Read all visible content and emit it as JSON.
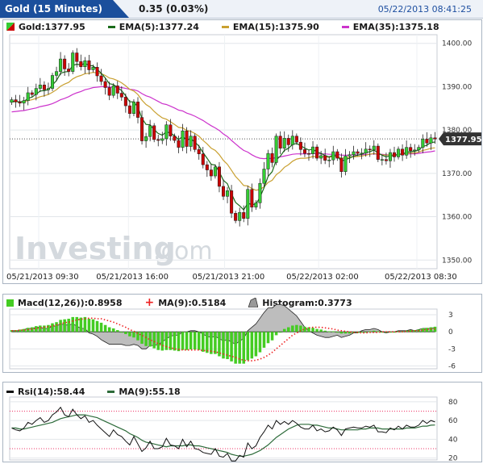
{
  "header": {
    "title": "Gold (15 Minutes)",
    "change": "0.35 (0.03%)",
    "timestamp": "05/22/2013 08:41:25"
  },
  "colors": {
    "up": "#33cc33",
    "down": "#cc0000",
    "ema5": "#1a6b1a",
    "ema15": "#c9a030",
    "ema35": "#cc33cc",
    "macd": "#44cc22",
    "macd_ma": "#ee2222",
    "histogram": "#999999",
    "rsi": "#111111",
    "rsi_ma": "#2d6b3a"
  },
  "main_legend": {
    "price_label": "Gold:1377.95",
    "ema5_label": "EMA(5):1377.24",
    "ema15_label": "EMA(15):1375.90",
    "ema35_label": "EMA(35):1375.18",
    "last_price_tag": "1377.95"
  },
  "macd_legend": {
    "macd_label": "Macd(12,26)):0.8958",
    "ma_label": "MA(9):0.5184",
    "hist_label": "Histogram:0.3773"
  },
  "rsi_legend": {
    "rsi_label": "Rsi(14):58.44",
    "ma_label": "MA(9):55.18"
  },
  "watermark": {
    "brand": "Investing",
    "suffix": ".com"
  },
  "chart_data": [
    {
      "type": "candlestick",
      "title": "Gold (15 Minutes)",
      "ylim": [
        1348,
        1402
      ],
      "y_ticks": [
        "1400.00",
        "1390.00",
        "1380.00",
        "1370.00",
        "1360.00",
        "1350.00"
      ],
      "x_ticks": [
        "05/21/2013 09:30",
        "05/21/2013 16:00",
        "05/21/2013 21:00",
        "05/22/2013 02:00",
        "05/22/2013 08:30"
      ],
      "series": [
        {
          "name": "Gold",
          "type": "candlestick",
          "last": 1377.95
        },
        {
          "name": "EMA(5)",
          "type": "line",
          "last": 1377.24
        },
        {
          "name": "EMA(15)",
          "type": "line",
          "last": 1375.9
        },
        {
          "name": "EMA(35)",
          "type": "line",
          "last": 1375.18
        }
      ],
      "close": [
        1387.0,
        1386.5,
        1386.2,
        1386.8,
        1388.6,
        1388.2,
        1389.6,
        1390.4,
        1389.3,
        1389.6,
        1392.6,
        1393.5,
        1396.4,
        1394.1,
        1393.5,
        1397.8,
        1395.8,
        1394.6,
        1396.0,
        1393.9,
        1394.5,
        1392.5,
        1391.2,
        1389.8,
        1388.0,
        1390.2,
        1388.5,
        1387.6,
        1385.6,
        1383.8,
        1386.5,
        1382.9,
        1377.5,
        1378.5,
        1381.0,
        1377.8,
        1377.6,
        1378.0,
        1381.2,
        1378.6,
        1377.6,
        1376.0,
        1379.8,
        1376.2,
        1378.6,
        1375.5,
        1374.5,
        1372.0,
        1370.8,
        1369.4,
        1371.5,
        1367.0,
        1364.7,
        1366.0,
        1360.8,
        1359.1,
        1361.0,
        1359.6,
        1366.3,
        1362.2,
        1363.2,
        1367.7,
        1371.0,
        1374.6,
        1372.5,
        1378.6,
        1375.8,
        1378.1,
        1376.6,
        1378.6,
        1377.2,
        1375.5,
        1374.6,
        1374.5,
        1376.1,
        1373.5,
        1374.1,
        1373.0,
        1373.1,
        1375.0,
        1373.5,
        1370.4,
        1374.0,
        1374.3,
        1375.0,
        1374.6,
        1374.7,
        1375.6,
        1375.4,
        1376.3,
        1373.2,
        1373.2,
        1372.9,
        1374.8,
        1373.8,
        1375.6,
        1374.2,
        1376.0,
        1375.2,
        1375.4,
        1376.0,
        1377.9,
        1377.0,
        1378.2,
        1377.95
      ],
      "open": [
        1386.4,
        1387.0,
        1386.5,
        1386.2,
        1386.8,
        1388.6,
        1388.2,
        1389.6,
        1390.4,
        1389.3,
        1389.6,
        1392.6,
        1393.5,
        1396.4,
        1394.1,
        1393.5,
        1397.8,
        1395.8,
        1394.6,
        1396.0,
        1393.9,
        1394.5,
        1392.5,
        1391.2,
        1389.8,
        1388.0,
        1390.2,
        1388.5,
        1387.6,
        1385.6,
        1383.8,
        1386.5,
        1382.9,
        1377.5,
        1378.5,
        1381.0,
        1377.8,
        1377.6,
        1378.0,
        1381.2,
        1378.6,
        1377.6,
        1376.0,
        1379.8,
        1376.2,
        1378.6,
        1375.5,
        1374.5,
        1372.0,
        1370.8,
        1369.4,
        1371.5,
        1367.0,
        1364.7,
        1366.0,
        1360.8,
        1359.1,
        1361.0,
        1359.6,
        1366.3,
        1362.2,
        1363.2,
        1367.7,
        1371.0,
        1374.6,
        1372.5,
        1378.6,
        1375.8,
        1378.1,
        1376.6,
        1378.6,
        1377.2,
        1375.5,
        1374.6,
        1374.5,
        1376.1,
        1373.5,
        1374.1,
        1373.0,
        1373.1,
        1375.0,
        1373.5,
        1370.4,
        1374.0,
        1374.3,
        1375.0,
        1374.6,
        1374.7,
        1375.6,
        1375.4,
        1376.3,
        1373.2,
        1373.2,
        1372.9,
        1374.8,
        1373.8,
        1375.6,
        1374.2,
        1376.0,
        1375.2,
        1375.4,
        1376.0,
        1377.9,
        1377.0,
        1378.2
      ],
      "ema5": [
        1386.6,
        1386.6,
        1386.5,
        1386.6,
        1387.3,
        1387.6,
        1388.3,
        1389.0,
        1389.1,
        1389.3,
        1390.4,
        1391.4,
        1393.1,
        1393.4,
        1393.5,
        1394.9,
        1395.2,
        1395.0,
        1395.4,
        1394.9,
        1394.8,
        1394.0,
        1393.1,
        1392.0,
        1390.7,
        1390.5,
        1389.8,
        1389.1,
        1387.9,
        1386.5,
        1386.5,
        1385.3,
        1382.7,
        1381.3,
        1381.2,
        1380.1,
        1379.2,
        1378.8,
        1379.6,
        1379.3,
        1378.7,
        1377.8,
        1378.5,
        1377.7,
        1378.0,
        1377.2,
        1376.3,
        1374.8,
        1373.5,
        1372.1,
        1371.9,
        1370.3,
        1368.4,
        1367.6,
        1365.3,
        1363.3,
        1362.5,
        1361.6,
        1363.1,
        1362.8,
        1362.9,
        1364.5,
        1366.7,
        1369.3,
        1370.4,
        1373.1,
        1374.0,
        1375.3,
        1375.8,
        1376.7,
        1376.9,
        1376.4,
        1375.8,
        1375.4,
        1375.6,
        1374.9,
        1374.6,
        1374.1,
        1373.8,
        1374.2,
        1374.0,
        1372.8,
        1373.2,
        1373.5,
        1374.0,
        1374.2,
        1374.4,
        1374.8,
        1375.0,
        1375.4,
        1374.7,
        1374.2,
        1373.8,
        1374.1,
        1374.0,
        1374.5,
        1374.4,
        1374.9,
        1375.0,
        1375.1,
        1375.4,
        1376.2,
        1376.5,
        1377.1,
        1377.24
      ],
      "ema15": [
        1386.5,
        1386.5,
        1386.5,
        1386.5,
        1386.8,
        1387.0,
        1387.3,
        1387.7,
        1387.9,
        1388.2,
        1388.7,
        1389.3,
        1390.1,
        1390.6,
        1391.0,
        1391.8,
        1392.3,
        1392.6,
        1393.0,
        1393.1,
        1393.3,
        1393.2,
        1393.0,
        1392.6,
        1392.0,
        1391.8,
        1391.4,
        1390.9,
        1390.2,
        1389.4,
        1389.0,
        1388.2,
        1386.9,
        1385.9,
        1385.3,
        1384.3,
        1383.5,
        1382.8,
        1382.5,
        1381.9,
        1381.3,
        1380.6,
        1380.5,
        1379.9,
        1379.7,
        1379.2,
        1378.6,
        1377.6,
        1376.8,
        1375.8,
        1375.3,
        1374.3,
        1373.0,
        1372.1,
        1370.7,
        1369.3,
        1368.3,
        1367.2,
        1367.1,
        1366.5,
        1366.1,
        1366.3,
        1366.9,
        1367.9,
        1368.4,
        1369.7,
        1370.4,
        1371.4,
        1372.0,
        1372.8,
        1373.3,
        1373.5,
        1373.5,
        1373.6,
        1373.9,
        1373.8,
        1373.9,
        1373.8,
        1373.7,
        1373.9,
        1373.9,
        1373.5,
        1373.6,
        1373.7,
        1373.8,
        1373.9,
        1374.0,
        1374.2,
        1374.4,
        1374.6,
        1374.4,
        1374.3,
        1374.2,
        1374.3,
        1374.2,
        1374.4,
        1374.4,
        1374.6,
        1374.7,
        1374.7,
        1374.9,
        1375.3,
        1375.5,
        1375.8,
        1375.9
      ],
      "ema35": [
        1384.2,
        1384.3,
        1384.4,
        1384.5,
        1384.7,
        1384.9,
        1385.1,
        1385.4,
        1385.6,
        1385.8,
        1386.1,
        1386.5,
        1387.0,
        1387.3,
        1387.7,
        1388.2,
        1388.6,
        1388.9,
        1389.3,
        1389.5,
        1389.8,
        1389.9,
        1390.0,
        1390.0,
        1389.9,
        1389.9,
        1389.9,
        1389.8,
        1389.6,
        1389.4,
        1389.3,
        1389.0,
        1388.4,
        1387.9,
        1387.6,
        1387.1,
        1386.6,
        1386.1,
        1385.9,
        1385.5,
        1385.1,
        1384.6,
        1384.4,
        1383.9,
        1383.6,
        1383.2,
        1382.7,
        1382.2,
        1381.6,
        1381.0,
        1380.5,
        1379.9,
        1379.1,
        1378.5,
        1377.6,
        1376.8,
        1376.0,
        1375.3,
        1374.9,
        1374.3,
        1373.8,
        1373.5,
        1373.4,
        1373.5,
        1373.4,
        1373.7,
        1373.8,
        1374.0,
        1374.2,
        1374.4,
        1374.5,
        1374.5,
        1374.5,
        1374.5,
        1374.6,
        1374.5,
        1374.5,
        1374.5,
        1374.4,
        1374.4,
        1374.4,
        1374.2,
        1374.2,
        1374.2,
        1374.3,
        1374.3,
        1374.3,
        1374.4,
        1374.4,
        1374.5,
        1374.4,
        1374.4,
        1374.3,
        1374.3,
        1374.3,
        1374.4,
        1374.4,
        1374.5,
        1374.5,
        1374.5,
        1374.6,
        1374.8,
        1374.9,
        1375.0,
        1375.18
      ]
    },
    {
      "type": "bar",
      "title": "Macd(12,26))",
      "ylim": [
        -6.5,
        4
      ],
      "y_ticks": [
        "3",
        "0",
        "-3",
        "-6"
      ],
      "series": [
        {
          "name": "Macd(12,26))",
          "type": "bar",
          "last": 0.8958
        },
        {
          "name": "MA(9)",
          "type": "dotted-line",
          "last": 0.5184
        },
        {
          "name": "Histogram",
          "type": "area",
          "last": 0.3773
        }
      ],
      "macd": [
        0.3,
        0.3,
        0.4,
        0.5,
        0.7,
        0.8,
        1.0,
        1.1,
        1.1,
        1.2,
        1.5,
        1.7,
        2.1,
        2.2,
        2.3,
        2.6,
        2.6,
        2.5,
        2.6,
        2.3,
        2.2,
        1.9,
        1.6,
        1.2,
        0.8,
        0.6,
        0.3,
        0.0,
        -0.4,
        -0.8,
        -1.0,
        -1.5,
        -2.1,
        -2.5,
        -2.6,
        -2.9,
        -3.2,
        -3.3,
        -3.2,
        -3.2,
        -3.3,
        -3.4,
        -3.2,
        -3.2,
        -3.1,
        -3.1,
        -3.2,
        -3.5,
        -3.7,
        -3.9,
        -3.9,
        -4.3,
        -4.7,
        -4.8,
        -5.2,
        -5.6,
        -5.6,
        -5.6,
        -5.0,
        -4.7,
        -4.3,
        -3.6,
        -2.8,
        -2.0,
        -1.5,
        -0.6,
        0.0,
        0.5,
        0.8,
        1.1,
        1.2,
        1.1,
        0.9,
        0.8,
        0.7,
        0.5,
        0.4,
        0.2,
        0.1,
        0.1,
        0.0,
        -0.3,
        -0.3,
        -0.3,
        -0.2,
        -0.2,
        -0.1,
        0.0,
        0.1,
        0.2,
        0.1,
        0.0,
        -0.1,
        0.0,
        0.0,
        0.1,
        0.1,
        0.2,
        0.3,
        0.3,
        0.4,
        0.6,
        0.7,
        0.8,
        0.8958
      ],
      "ma9": [
        0.2,
        0.2,
        0.3,
        0.3,
        0.4,
        0.5,
        0.6,
        0.7,
        0.8,
        0.9,
        1.0,
        1.2,
        1.4,
        1.6,
        1.7,
        1.9,
        2.1,
        2.2,
        2.3,
        2.4,
        2.4,
        2.3,
        2.3,
        2.1,
        1.9,
        1.7,
        1.4,
        1.1,
        0.8,
        0.4,
        0.1,
        -0.3,
        -0.6,
        -1.0,
        -1.4,
        -1.7,
        -2.1,
        -2.4,
        -2.6,
        -2.8,
        -3.0,
        -3.1,
        -3.2,
        -3.2,
        -3.2,
        -3.2,
        -3.2,
        -3.3,
        -3.3,
        -3.4,
        -3.5,
        -3.7,
        -3.9,
        -4.1,
        -4.3,
        -4.5,
        -4.8,
        -5.0,
        -5.1,
        -5.1,
        -5.0,
        -4.8,
        -4.5,
        -4.1,
        -3.6,
        -3.0,
        -2.4,
        -1.8,
        -1.2,
        -0.6,
        -0.2,
        0.2,
        0.5,
        0.7,
        0.8,
        0.8,
        0.8,
        0.7,
        0.6,
        0.5,
        0.3,
        0.2,
        0.1,
        0.0,
        -0.1,
        -0.1,
        -0.2,
        -0.2,
        -0.1,
        -0.1,
        -0.1,
        0.0,
        0.0,
        0.0,
        0.0,
        0.0,
        0.0,
        0.1,
        0.1,
        0.2,
        0.2,
        0.3,
        0.4,
        0.5,
        0.5184
      ]
    },
    {
      "type": "line",
      "title": "Rsi(14)",
      "ylim": [
        18,
        85
      ],
      "y_ticks": [
        "80",
        "60",
        "40",
        "20"
      ],
      "series": [
        {
          "name": "Rsi(14)",
          "last": 58.44
        },
        {
          "name": "MA(9)",
          "last": 55.18
        }
      ],
      "rsi": [
        52,
        50,
        49,
        52,
        58,
        56,
        60,
        63,
        58,
        60,
        66,
        69,
        74,
        66,
        64,
        72,
        66,
        62,
        65,
        58,
        60,
        55,
        51,
        47,
        43,
        50,
        45,
        43,
        38,
        34,
        43,
        35,
        27,
        31,
        38,
        30,
        30,
        32,
        41,
        34,
        33,
        30,
        40,
        32,
        38,
        30,
        29,
        26,
        25,
        24,
        30,
        22,
        21,
        25,
        17,
        17,
        23,
        21,
        36,
        30,
        33,
        42,
        48,
        55,
        51,
        60,
        56,
        59,
        56,
        60,
        57,
        53,
        51,
        51,
        55,
        49,
        51,
        48,
        49,
        53,
        50,
        44,
        51,
        52,
        53,
        52,
        52,
        54,
        53,
        55,
        48,
        48,
        47,
        52,
        50,
        54,
        51,
        55,
        53,
        53,
        55,
        60,
        57,
        60,
        58.44
      ],
      "ma9": [
        52,
        52,
        51,
        51,
        52,
        53,
        54,
        55,
        56,
        57,
        58,
        60,
        62,
        63,
        64,
        65,
        66,
        66,
        66,
        65,
        64,
        63,
        61,
        59,
        57,
        55,
        53,
        51,
        49,
        46,
        44,
        42,
        39,
        37,
        36,
        35,
        34,
        33,
        32,
        33,
        33,
        33,
        33,
        34,
        34,
        33,
        33,
        32,
        31,
        30,
        29,
        28,
        27,
        26,
        24,
        23,
        22,
        22,
        23,
        24,
        26,
        28,
        31,
        34,
        38,
        42,
        45,
        48,
        51,
        53,
        55,
        56,
        56,
        56,
        55,
        55,
        54,
        53,
        52,
        52,
        51,
        50,
        50,
        50,
        50,
        50,
        51,
        51,
        52,
        52,
        52,
        51,
        51,
        51,
        51,
        51,
        51,
        52,
        52,
        52,
        53,
        54,
        54,
        55,
        55.18
      ]
    }
  ]
}
